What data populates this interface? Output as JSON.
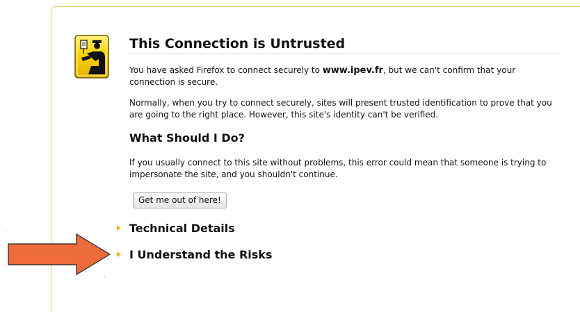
{
  "error_page": {
    "title": "This Connection is Untrusted",
    "intro_prefix": "You have asked Firefox to connect securely to ",
    "intro_host": "www.ipev.fr",
    "intro_suffix": ", but we can't confirm that your connection is secure.",
    "explanation": "Normally, when you try to connect securely, sites will present trusted identification to prove that you are going to the right place. However, this site's identity can't be verified.",
    "what_heading": "What Should I Do?",
    "advice": "If you usually connect to this site without problems, this error could mean that someone is trying to impersonate the site, and you shouldn't continue.",
    "exit_button_label": "Get me out of here!",
    "technical_details_label": "Technical Details",
    "understand_risks_label": "I Understand the Risks"
  },
  "icons": {
    "warning": "untrusted-connection-icon",
    "annotation": "orange-arrow-icon"
  },
  "colors": {
    "frame_border": "#f0c86a",
    "expander_triangle": "#f2b400",
    "annotation_arrow": "#ee6b3c",
    "icon_yellow": "#f6d000"
  }
}
